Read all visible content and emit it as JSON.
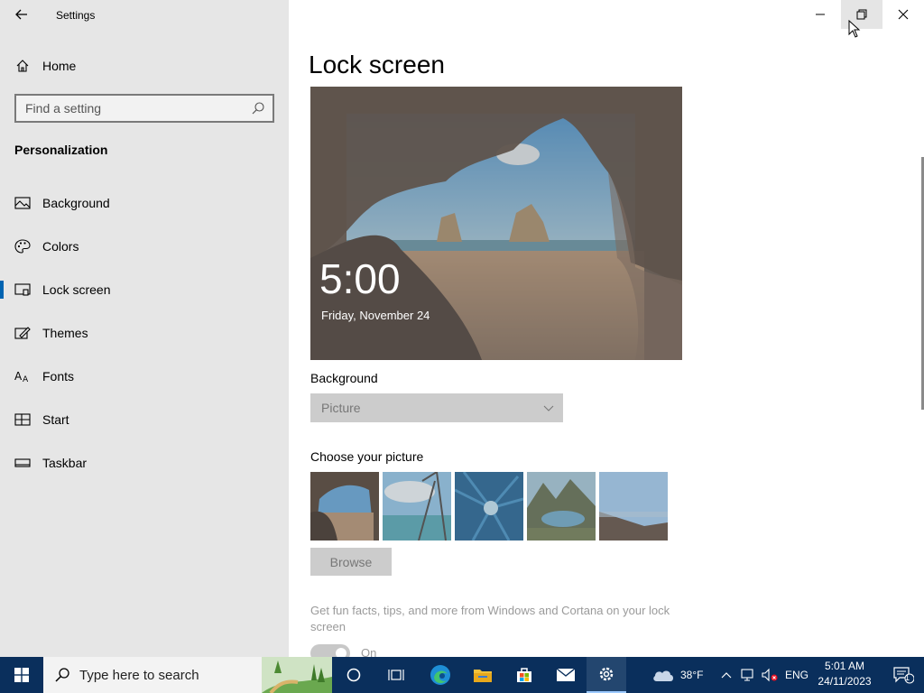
{
  "window": {
    "title": "Settings"
  },
  "sidebar": {
    "home_label": "Home",
    "search_placeholder": "Find a setting",
    "section_title": "Personalization",
    "items": [
      {
        "label": "Background",
        "icon": "picture-icon"
      },
      {
        "label": "Colors",
        "icon": "palette-icon"
      },
      {
        "label": "Lock screen",
        "icon": "lock-screen-icon",
        "active": true
      },
      {
        "label": "Themes",
        "icon": "themes-icon"
      },
      {
        "label": "Fonts",
        "icon": "fonts-icon"
      },
      {
        "label": "Start",
        "icon": "start-icon"
      },
      {
        "label": "Taskbar",
        "icon": "taskbar-icon"
      }
    ]
  },
  "main": {
    "title": "Lock screen",
    "preview": {
      "time": "5:00",
      "date": "Friday, November 24"
    },
    "background_label": "Background",
    "background_value": "Picture",
    "choose_picture_label": "Choose your picture",
    "browse_label": "Browse",
    "tips_text": "Get fun facts, tips, and more from Windows and Cortana on your lock screen",
    "tips_toggle_state": "On"
  },
  "taskbar": {
    "search_placeholder": "Type here to search",
    "weather_temp": "38°F",
    "language": "ENG",
    "time": "5:01 AM",
    "date": "24/11/2023",
    "notification_count": "1"
  },
  "colors": {
    "accent": "#0063b1",
    "sidebar_bg": "#e6e6e6",
    "taskbar_bg": "#0a2f5c"
  }
}
